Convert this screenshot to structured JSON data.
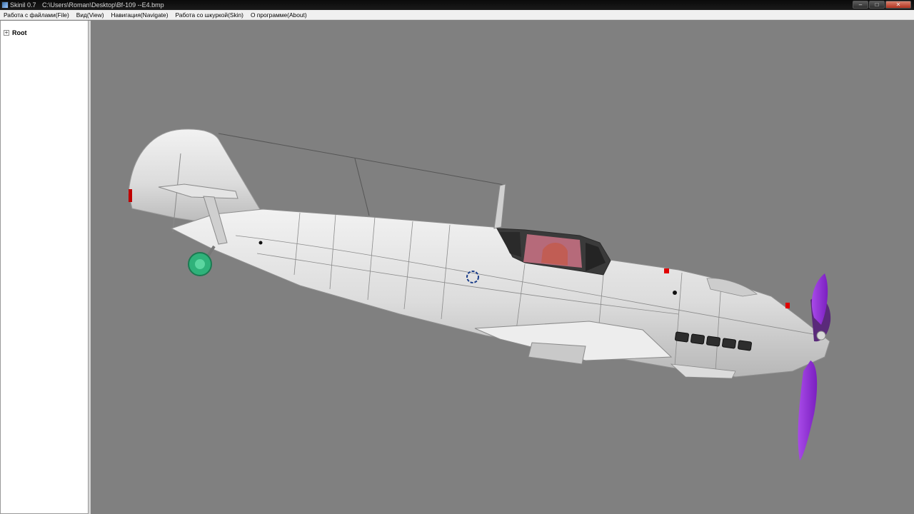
{
  "window": {
    "app": "Skinil 0.7",
    "file_path": "C:\\Users\\Roman\\Desktop\\Bf-109 --E4.bmp",
    "controls": {
      "minimize": "–",
      "maximize": "□",
      "close": "✕"
    }
  },
  "menu": [
    {
      "label": "Работа с файлами(File)"
    },
    {
      "label": "Вид(View)"
    },
    {
      "label": "Навигация(Navigate)"
    },
    {
      "label": "Работа со шкуркой(Skin)"
    },
    {
      "label": "О программе(About)"
    }
  ],
  "tree": {
    "expander": "+",
    "root_label": "Root"
  },
  "viewport": {
    "background": "#808080",
    "colors": {
      "fuselage": "#d9d9d9",
      "canopy": "#b66a7a",
      "propeller": "#8f2fd0",
      "spinner": "#5a2a7a",
      "wheel": "#2fb27a",
      "marker": "#e00000"
    }
  }
}
